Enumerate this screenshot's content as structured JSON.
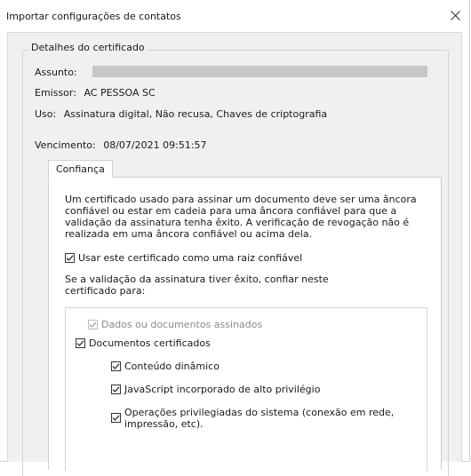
{
  "window": {
    "title": "Importar configurações de contatos",
    "close_glyph": "✕"
  },
  "details": {
    "legend": "Detalhes do certificado",
    "subject_label": "Assunto:",
    "issuer_label": "Emissor:",
    "issuer_value": "AC PESSOA SC",
    "usage_label": "Uso:",
    "usage_value": "Assinatura digital, Não recusa, Chaves de criptografia",
    "expiry_label": "Vencimento:",
    "expiry_value": "08/07/2021 09:51:57"
  },
  "tabs": [
    {
      "label": "Confiança",
      "active": true
    }
  ],
  "trust": {
    "description": "Um certificado usado para assinar um documento deve ser uma âncora confiável ou estar em cadeia para uma âncora confiável para que a validação da assinatura tenha êxito. A verificação de revogação não é realizada em uma âncora confiável ou acima dela.",
    "root_checkbox": {
      "label": "Usar este certificado como uma raiz confiável",
      "checked": true
    },
    "trust_intro": "Se a validação da assinatura tiver êxito, confiar neste certificado para:",
    "options": [
      {
        "label": "Dados ou documentos assinados",
        "checked": true,
        "disabled": true
      },
      {
        "label": "Documentos certificados",
        "checked": true,
        "disabled": false
      },
      {
        "label": "Conteúdo dinâmico",
        "checked": true,
        "disabled": false
      },
      {
        "label": "JavaScript incorporado de alto privilégio",
        "checked": true,
        "disabled": false
      },
      {
        "label": "Operações privilegiadas do sistema (conexão em rede, impressão, etc).",
        "checked": true,
        "disabled": false
      }
    ]
  },
  "colors": {
    "dialog_bg": "#f0f0f0",
    "panel_bg": "#ffffff",
    "border": "#cfcfcf",
    "redaction": "#c7c7c7",
    "disabled_text": "#8a8a8a"
  },
  "icons": {
    "close": "close-icon",
    "check": "check-icon"
  }
}
